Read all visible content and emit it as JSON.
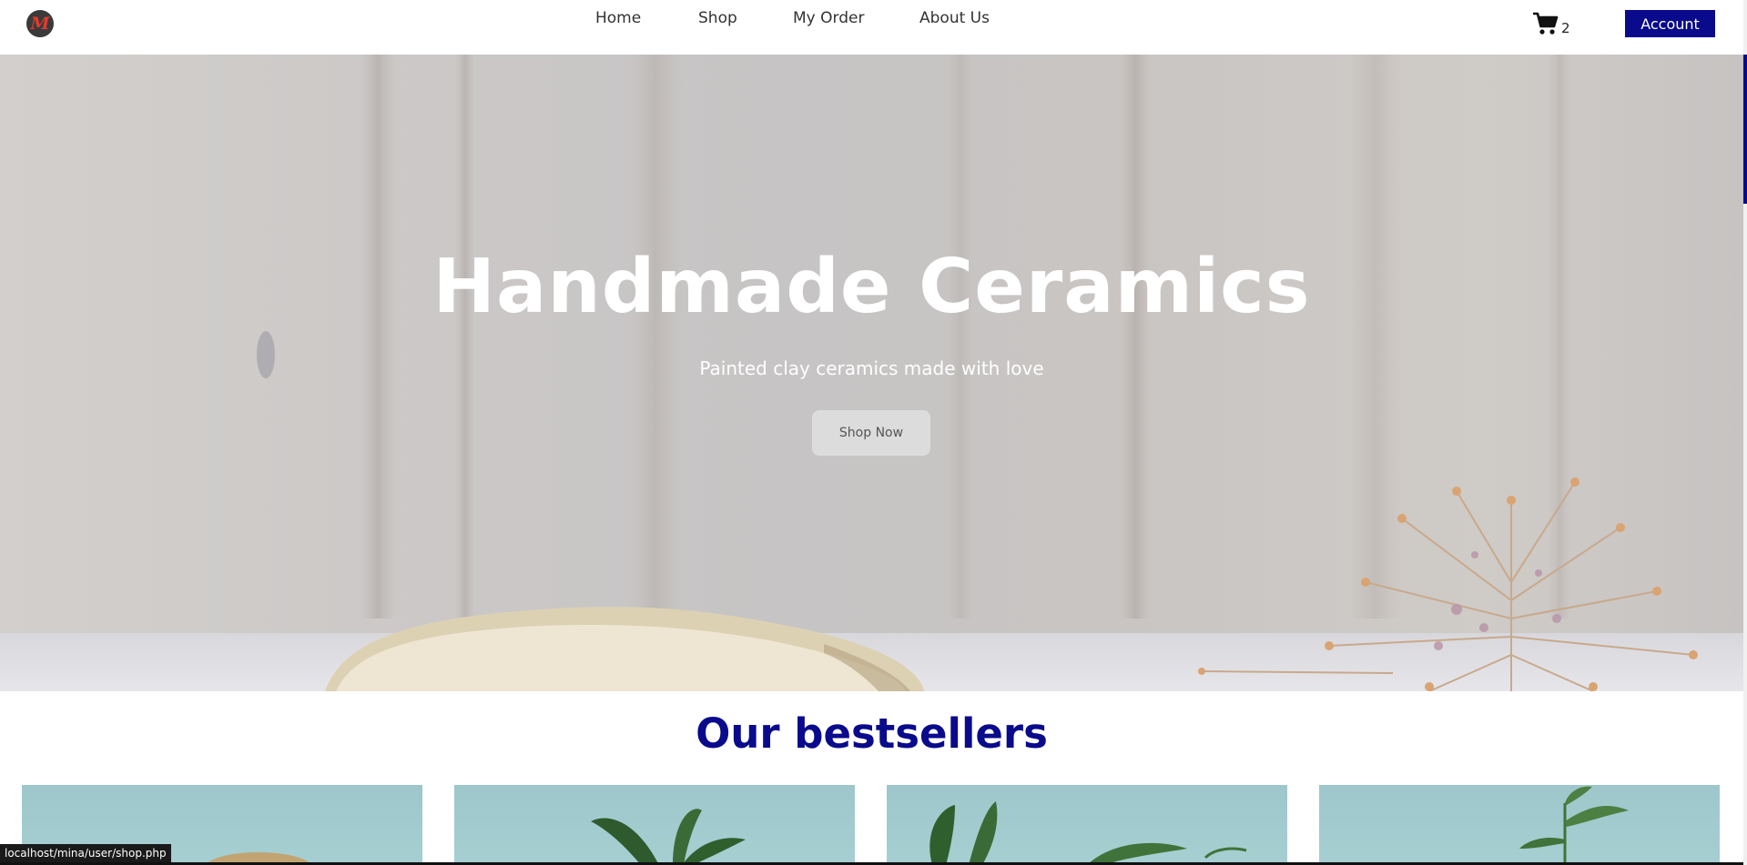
{
  "header": {
    "logo_letter": "M",
    "nav": [
      "Home",
      "Shop",
      "My Order",
      "About Us"
    ],
    "cart_count": "2",
    "account_label": "Account"
  },
  "hero": {
    "title": "Handmade Ceramics",
    "subtitle": "Painted clay ceramics made with love",
    "button_label": "Shop Now"
  },
  "section_title": "Our bestsellers",
  "status_url": "localhost/mina/user/shop.php",
  "colors": {
    "accent": "#0a0a8c",
    "logo_red": "#e23b2e",
    "card_bg": "#a4cdd0"
  },
  "icons": [
    "logo-icon",
    "cart-icon"
  ]
}
